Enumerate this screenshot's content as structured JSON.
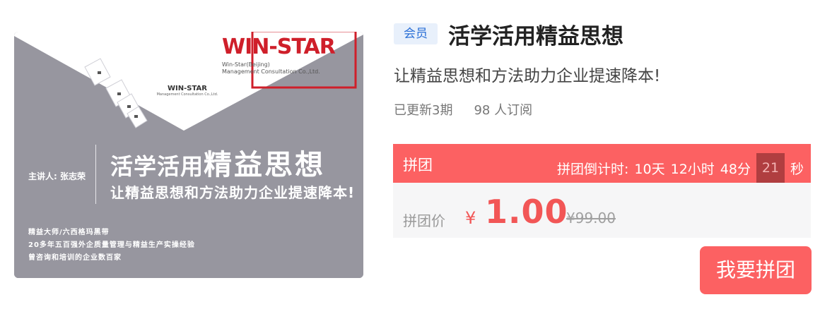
{
  "cover": {
    "logo_brand": "WIN-STAR",
    "logo_sub_line1": "Win-Star(Beijing)",
    "logo_sub_line2": "Management Consultation Co.,Ltd.",
    "small_logo_brand": "WIN-STAR",
    "small_logo_sub": "Management Consultation Co.,Ltd.",
    "lecturer": "主讲人: 张志荣",
    "title_part1": "活学活用",
    "title_part2": "精益思想",
    "subtitle": "让精益思想和方法助力企业提速降本!",
    "info_lines": [
      "精益大师/六西格玛黑带",
      "20多年五百强外企质量管理与精益生产实操经验",
      "曾咨询和培训的企业数百家"
    ]
  },
  "course": {
    "badge": "会员",
    "title": "活学活用精益思想",
    "subtitle": "让精益思想和方法助力企业提速降本!",
    "updated": "已更新3期",
    "subscribers": "98 人订阅"
  },
  "group": {
    "label": "拼团",
    "countdown_label": "拼团倒计时:",
    "days": "10天",
    "hours": "12小时",
    "minutes": "48分",
    "seconds_value": "21",
    "seconds_unit": "秒"
  },
  "price": {
    "label": "拼团价",
    "currency": "¥",
    "amount": "1.00",
    "original": "¥99.00"
  },
  "actions": {
    "join_label": "我要拼团"
  },
  "colors": {
    "accent_red": "#fc6162",
    "price_red": "#f25656",
    "cover_gray": "#97969f",
    "vip_blue": "#2a6fd6"
  }
}
